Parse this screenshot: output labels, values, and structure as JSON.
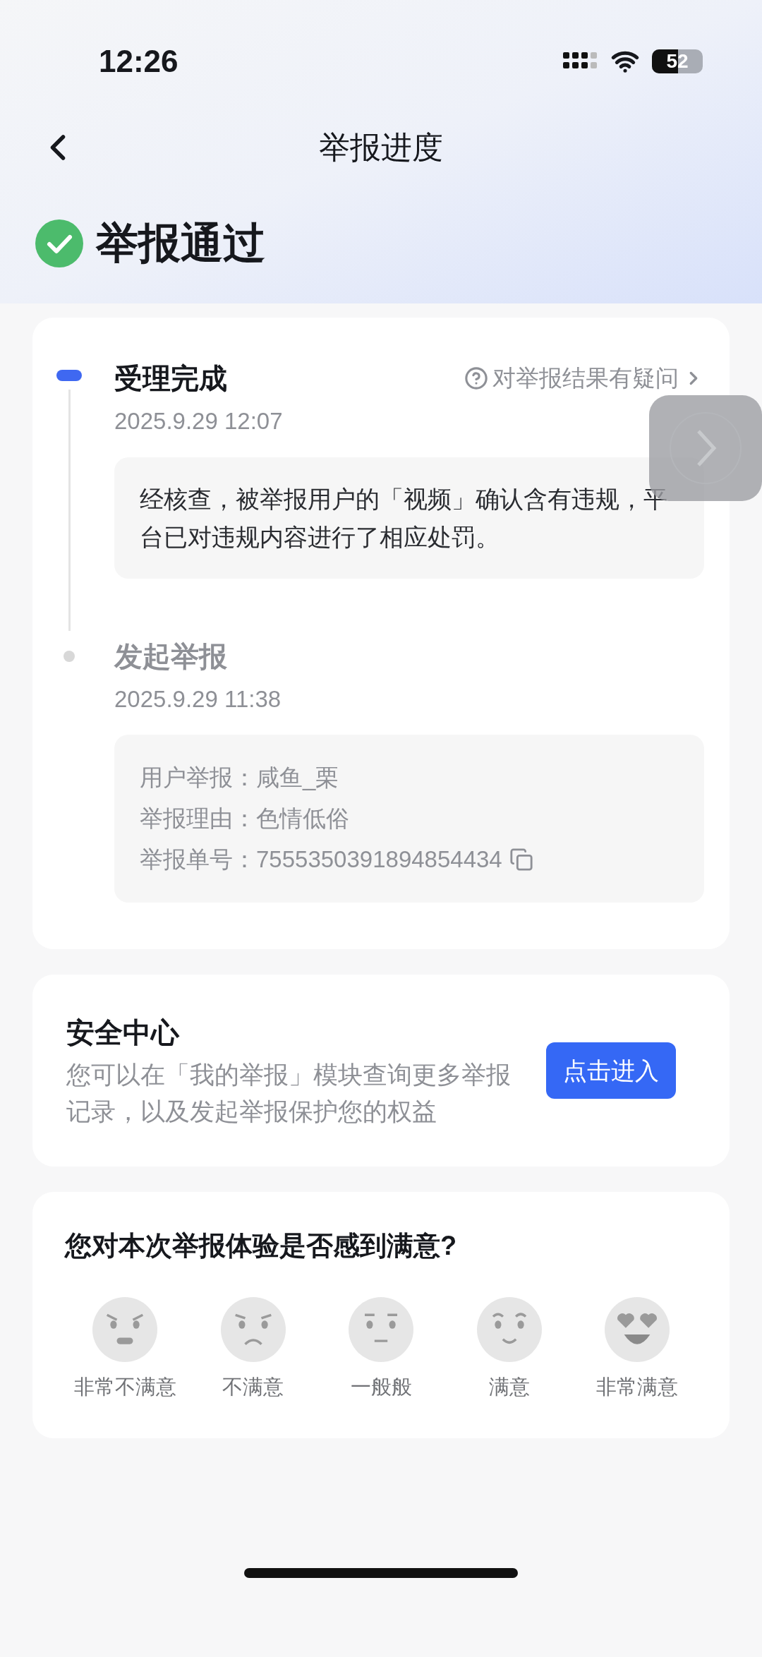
{
  "status_bar": {
    "time": "12:26",
    "battery": "52"
  },
  "nav": {
    "title": "举报进度"
  },
  "result": {
    "title": "举报通过"
  },
  "timeline": {
    "question_link": "对举报结果有疑问",
    "steps": [
      {
        "title": "受理完成",
        "time": "2025.9.29 12:07",
        "active": true,
        "kind": "message",
        "lines": [
          "经核查，被举报用户的「视频」确认含有违规，平台已对违规内容进行了相应处罚。"
        ]
      },
      {
        "title": "发起举报",
        "time": "2025.9.29 11:38",
        "active": false,
        "kind": "details",
        "lines": [
          "用户举报：咸鱼_栗",
          "举报理由：色情低俗",
          "举报单号：7555350391894854434"
        ]
      }
    ]
  },
  "safety": {
    "title": "安全中心",
    "text": "您可以在「我的举报」模块查询更多举报记录，以及发起举报保护您的权益",
    "button": "点击进入"
  },
  "survey": {
    "question": "您对本次举报体验是否感到满意?",
    "options": [
      {
        "label": "非常不满意",
        "kind": "angry"
      },
      {
        "label": "不满意",
        "kind": "sad"
      },
      {
        "label": "一般般",
        "kind": "neutral"
      },
      {
        "label": "满意",
        "kind": "smile"
      },
      {
        "label": "非常满意",
        "kind": "love"
      }
    ]
  }
}
